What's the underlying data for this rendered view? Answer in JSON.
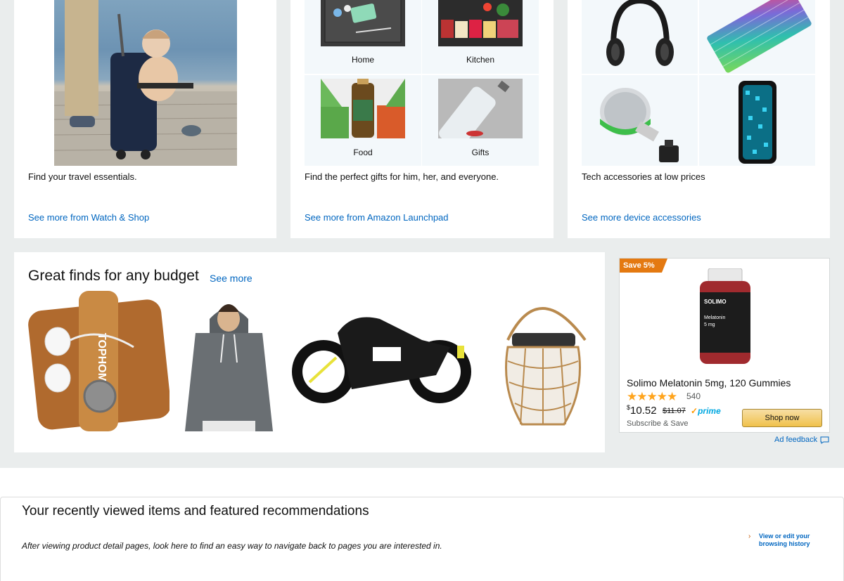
{
  "cards": [
    {
      "description": "Find your travel essentials.",
      "link": "See more from Watch & Shop"
    },
    {
      "tiles": [
        "Home",
        "Kitchen",
        "Food",
        "Gifts"
      ],
      "description": "Find the perfect gifts for him, her, and everyone.",
      "link": "See more from Amazon Launchpad"
    },
    {
      "description": "Tech accessories at low prices",
      "link": "See more device accessories"
    }
  ],
  "finds": {
    "title": "Great finds for any budget",
    "see_more": "See more",
    "logo_text": "TOPHOME"
  },
  "ad": {
    "badge": "Save 5%",
    "product_brand": "SOLIMO",
    "product_label_line1": "Melatonin",
    "product_label_line2": "5 mg",
    "title": "Solimo Melatonin 5mg, 120 Gummies",
    "stars": "★★★★★",
    "rating_count": "540",
    "price_symbol": "$",
    "price": "10.52",
    "list_price": "$11.07",
    "prime": "prime",
    "subscribe": "Subscribe & Save",
    "button": "Shop now",
    "feedback": "Ad feedback"
  },
  "recent": {
    "title": "Your recently viewed items and featured recommendations",
    "description": "After viewing product detail pages, look here to find an easy way to navigate back to pages you are interested in.",
    "history_arrow": "›",
    "history_link": "View or edit your browsing history"
  },
  "colors": {
    "link": "#0066c0",
    "badge": "#e47911",
    "stars": "#ffa41c",
    "prime": "#00a8e1",
    "button": "#f0c14b"
  }
}
